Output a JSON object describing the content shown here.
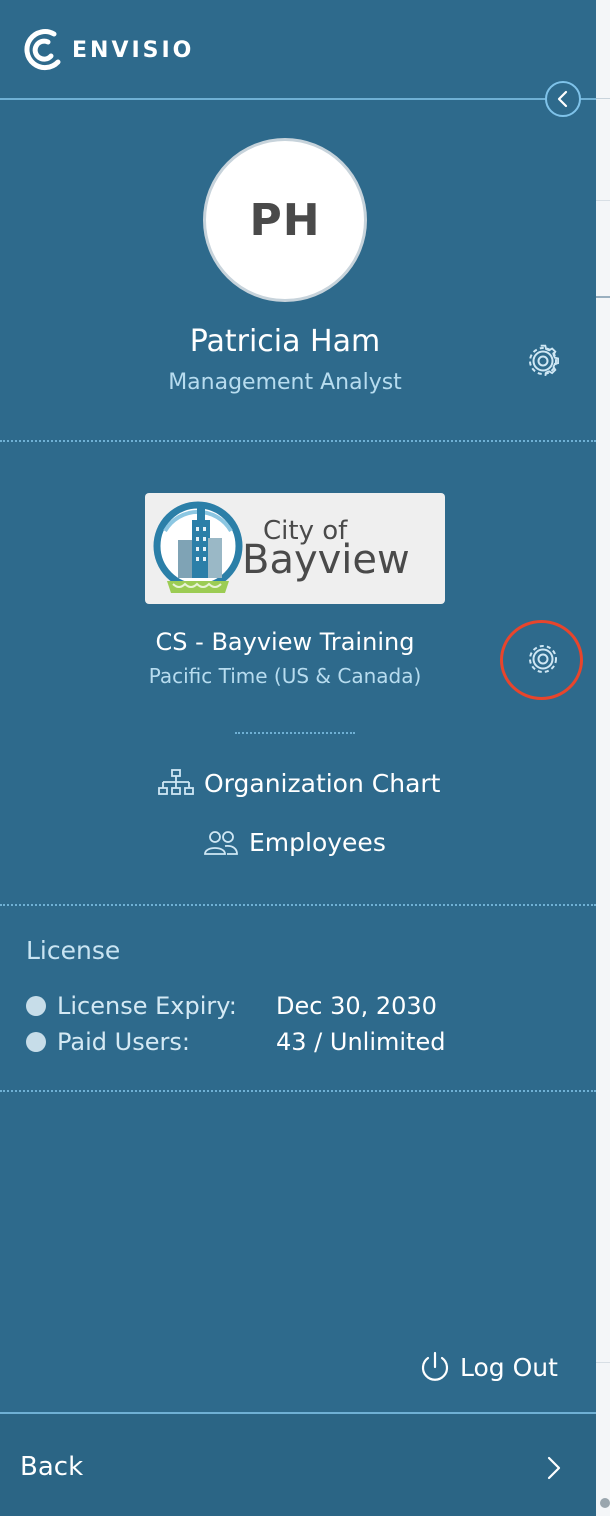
{
  "brand": {
    "name": "ENVISIO"
  },
  "user": {
    "initials": "PH",
    "name": "Patricia Ham",
    "role": "Management Analyst"
  },
  "organization": {
    "logo_text_line1": "City of",
    "logo_text_line2": "Bayview",
    "name": "CS - Bayview Training",
    "timezone": "Pacific Time (US & Canada)"
  },
  "nav": {
    "org_chart": "Organization Chart",
    "employees": "Employees"
  },
  "license": {
    "title": "License",
    "rows": [
      {
        "label": "License Expiry:",
        "value": "Dec 30, 2030"
      },
      {
        "label": "Paid Users:",
        "value": "43 / Unlimited"
      }
    ]
  },
  "actions": {
    "logout": "Log Out",
    "back": "Back"
  },
  "icons": {
    "collapse": "chevron-left-icon",
    "user_settings": "gear-icon",
    "org_settings": "gear-icon",
    "org_chart": "org-chart-icon",
    "employees": "users-icon",
    "logout": "power-icon",
    "back": "chevron-right-icon"
  },
  "colors": {
    "panel": "#2e6a8c",
    "accent_line": "#6fb0d4",
    "highlight": "#e8452c"
  }
}
